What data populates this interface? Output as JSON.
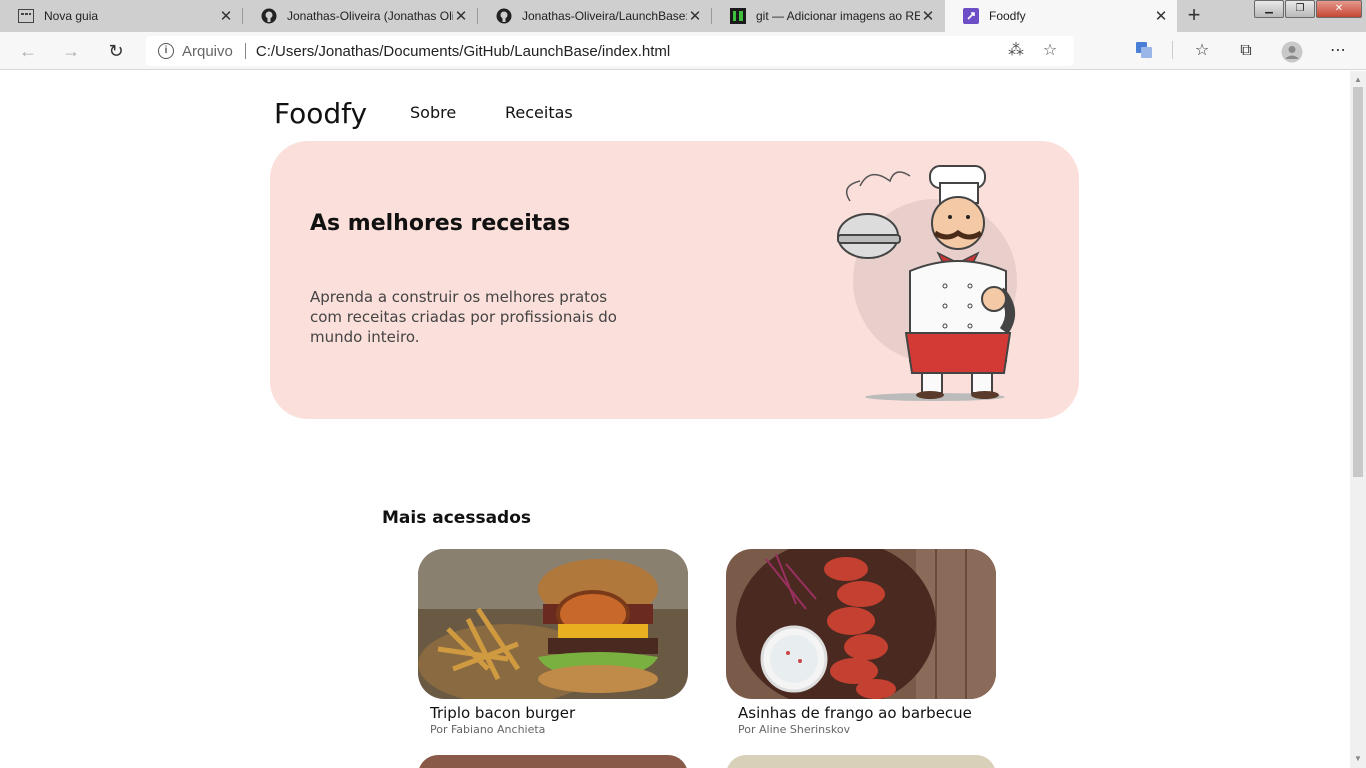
{
  "browser": {
    "tabs": [
      {
        "title": "Nova guia",
        "icon": "new-tab-icon"
      },
      {
        "title": "Jonathas-Oliveira (Jonathas Oliveira)",
        "icon": "github-icon"
      },
      {
        "title": "Jonathas-Oliveira/LaunchBase: Ex",
        "icon": "github-icon"
      },
      {
        "title": "git — Adicionar imagens ao README",
        "icon": "stackoverflow-icon"
      },
      {
        "title": "Foodfy",
        "icon": "foodfy-favicon-icon"
      }
    ],
    "new_tab_glyph": "+",
    "site_label": "Arquivo",
    "url": "C:/Users/Jonathas/Documents/GitHub/LaunchBase/index.html"
  },
  "header": {
    "logo": "Foodfy",
    "nav": [
      "Sobre",
      "Receitas"
    ]
  },
  "hero": {
    "title": "As melhores receitas",
    "text": "Aprenda a construir os melhores pratos com receitas criadas por profissionais do mundo inteiro."
  },
  "section": {
    "title": "Mais acessados"
  },
  "recipes": [
    {
      "title": "Triplo bacon burger",
      "author": "Por Fabiano Anchieta"
    },
    {
      "title": "Asinhas de frango ao barbecue",
      "author": "Por Aline Sherinskov"
    }
  ]
}
